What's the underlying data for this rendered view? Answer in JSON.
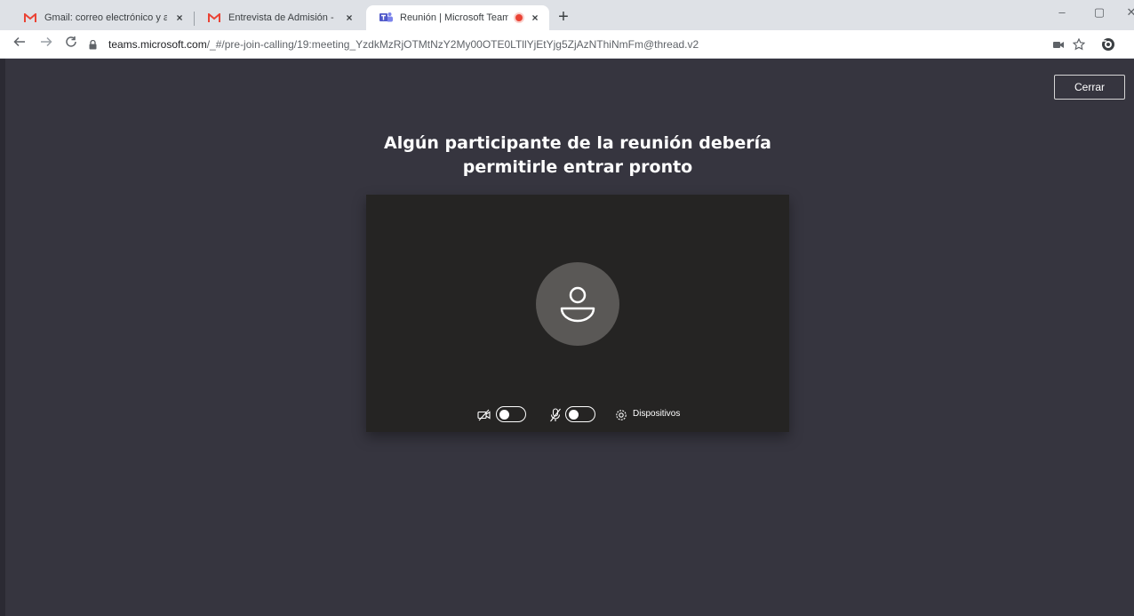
{
  "browser": {
    "tabs": [
      {
        "title": "Gmail: correo electrónico y almac",
        "icon": "gmail-icon"
      },
      {
        "title": "Entrevista de Admisión - erpacal",
        "icon": "gmail-icon"
      },
      {
        "title": "Reunión | Microsoft Teams",
        "icon": "teams-icon",
        "recording": true
      }
    ],
    "new_tab_label": "+",
    "close_tab_label": "×",
    "address": {
      "host": "teams.microsoft.com",
      "path": "/_#/pre-join-calling/19:meeting_YzdkMzRjOTMtNzY2My00OTE0LTllYjEtYjg5ZjAzNThiNmFm@thread.v2"
    },
    "window_controls": [
      "–",
      "▢",
      "✕"
    ]
  },
  "teams": {
    "close_label": "Cerrar",
    "heading_line1": "Algún participante de la reunión debería",
    "heading_line2": "permitirle entrar pronto",
    "camera_toggle_on": false,
    "mic_toggle_on": false,
    "devices_label": "Dispositivos"
  },
  "colors": {
    "background": "#36353f",
    "preview": "#252423",
    "avatar": "#5a5856",
    "gmail_red": "#ea4335",
    "teams_purple": "#5059c9"
  }
}
